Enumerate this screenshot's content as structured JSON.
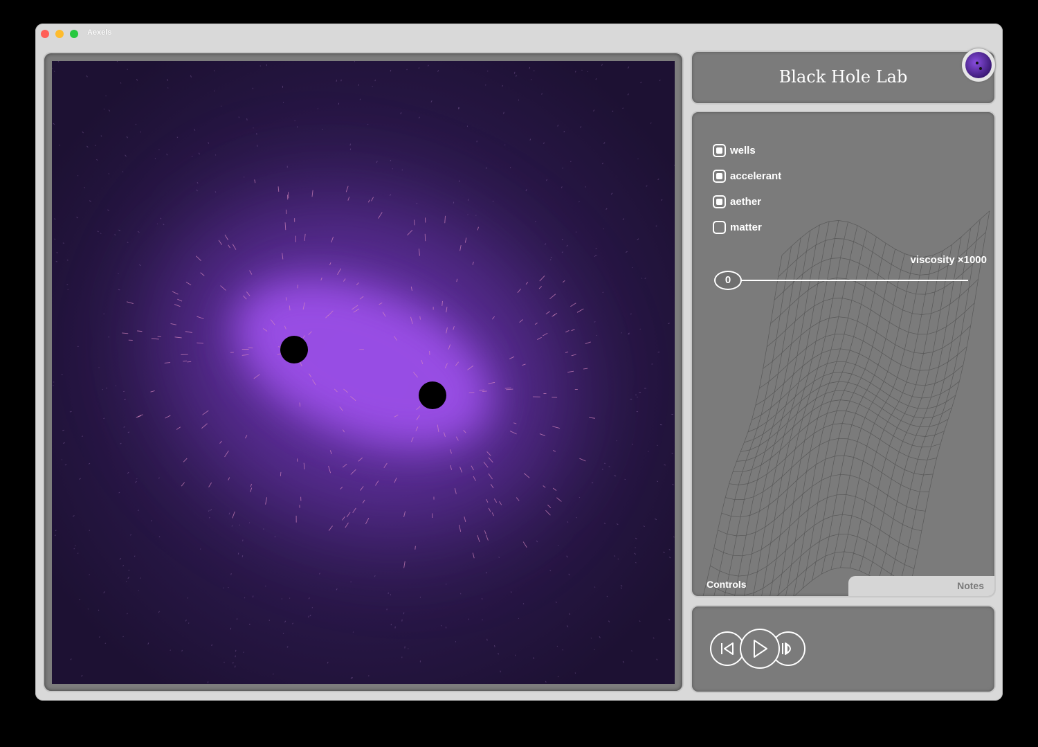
{
  "window": {
    "app_title": "Aexels"
  },
  "header": {
    "title": "Black Hole Lab",
    "logo_icon": "black-hole-logo-icon"
  },
  "controls": {
    "checkboxes": [
      {
        "label": "wells",
        "checked": true
      },
      {
        "label": "accelerant",
        "checked": true
      },
      {
        "label": "aether",
        "checked": true
      },
      {
        "label": "matter",
        "checked": false
      }
    ],
    "slider": {
      "label": "viscosity ×1000",
      "value": "0"
    }
  },
  "tabs": {
    "active": "Controls",
    "inactive": "Notes"
  },
  "transport": {
    "buttons": [
      "step-back-icon",
      "play-icon",
      "step-forward-icon"
    ]
  },
  "colors": {
    "space_background": "#1a1030",
    "glow": "#9b4fe8",
    "panel_gray": "#7b7b7b",
    "frame_gray": "#d9d9d9"
  }
}
